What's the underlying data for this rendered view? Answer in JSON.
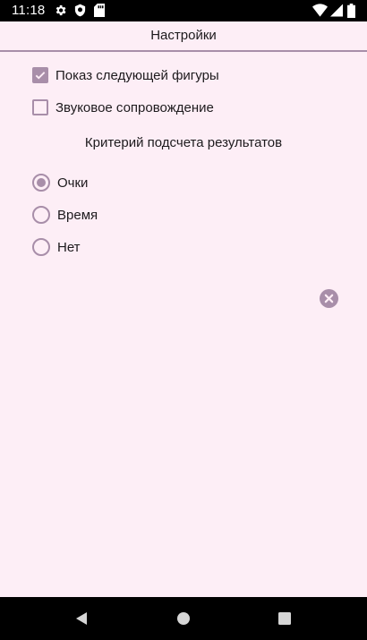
{
  "status_bar": {
    "time": "11:18",
    "icons_left": [
      "gear-icon",
      "shield-icon",
      "sd-card-icon"
    ],
    "icons_right": [
      "wifi-icon",
      "signal-icon",
      "battery-icon"
    ]
  },
  "header": {
    "title": "Настройки"
  },
  "settings": {
    "show_next_shape": {
      "label": "Показ следующей фигуры",
      "checked": true
    },
    "sound": {
      "label": "Звуковое сопровождение",
      "checked": false
    }
  },
  "scoring": {
    "title": "Критерий подсчета результатов",
    "options": [
      {
        "label": "Очки",
        "selected": true
      },
      {
        "label": "Время",
        "selected": false
      },
      {
        "label": "Нет",
        "selected": false
      }
    ]
  },
  "close_button": {
    "icon": "close-icon"
  },
  "nav_bar": {
    "buttons": [
      "back-icon",
      "home-icon",
      "recents-icon"
    ]
  },
  "colors": {
    "background": "#fdeef6",
    "accent": "#a88ea9",
    "text": "#1d1a1d",
    "system_bars": "#000000"
  }
}
